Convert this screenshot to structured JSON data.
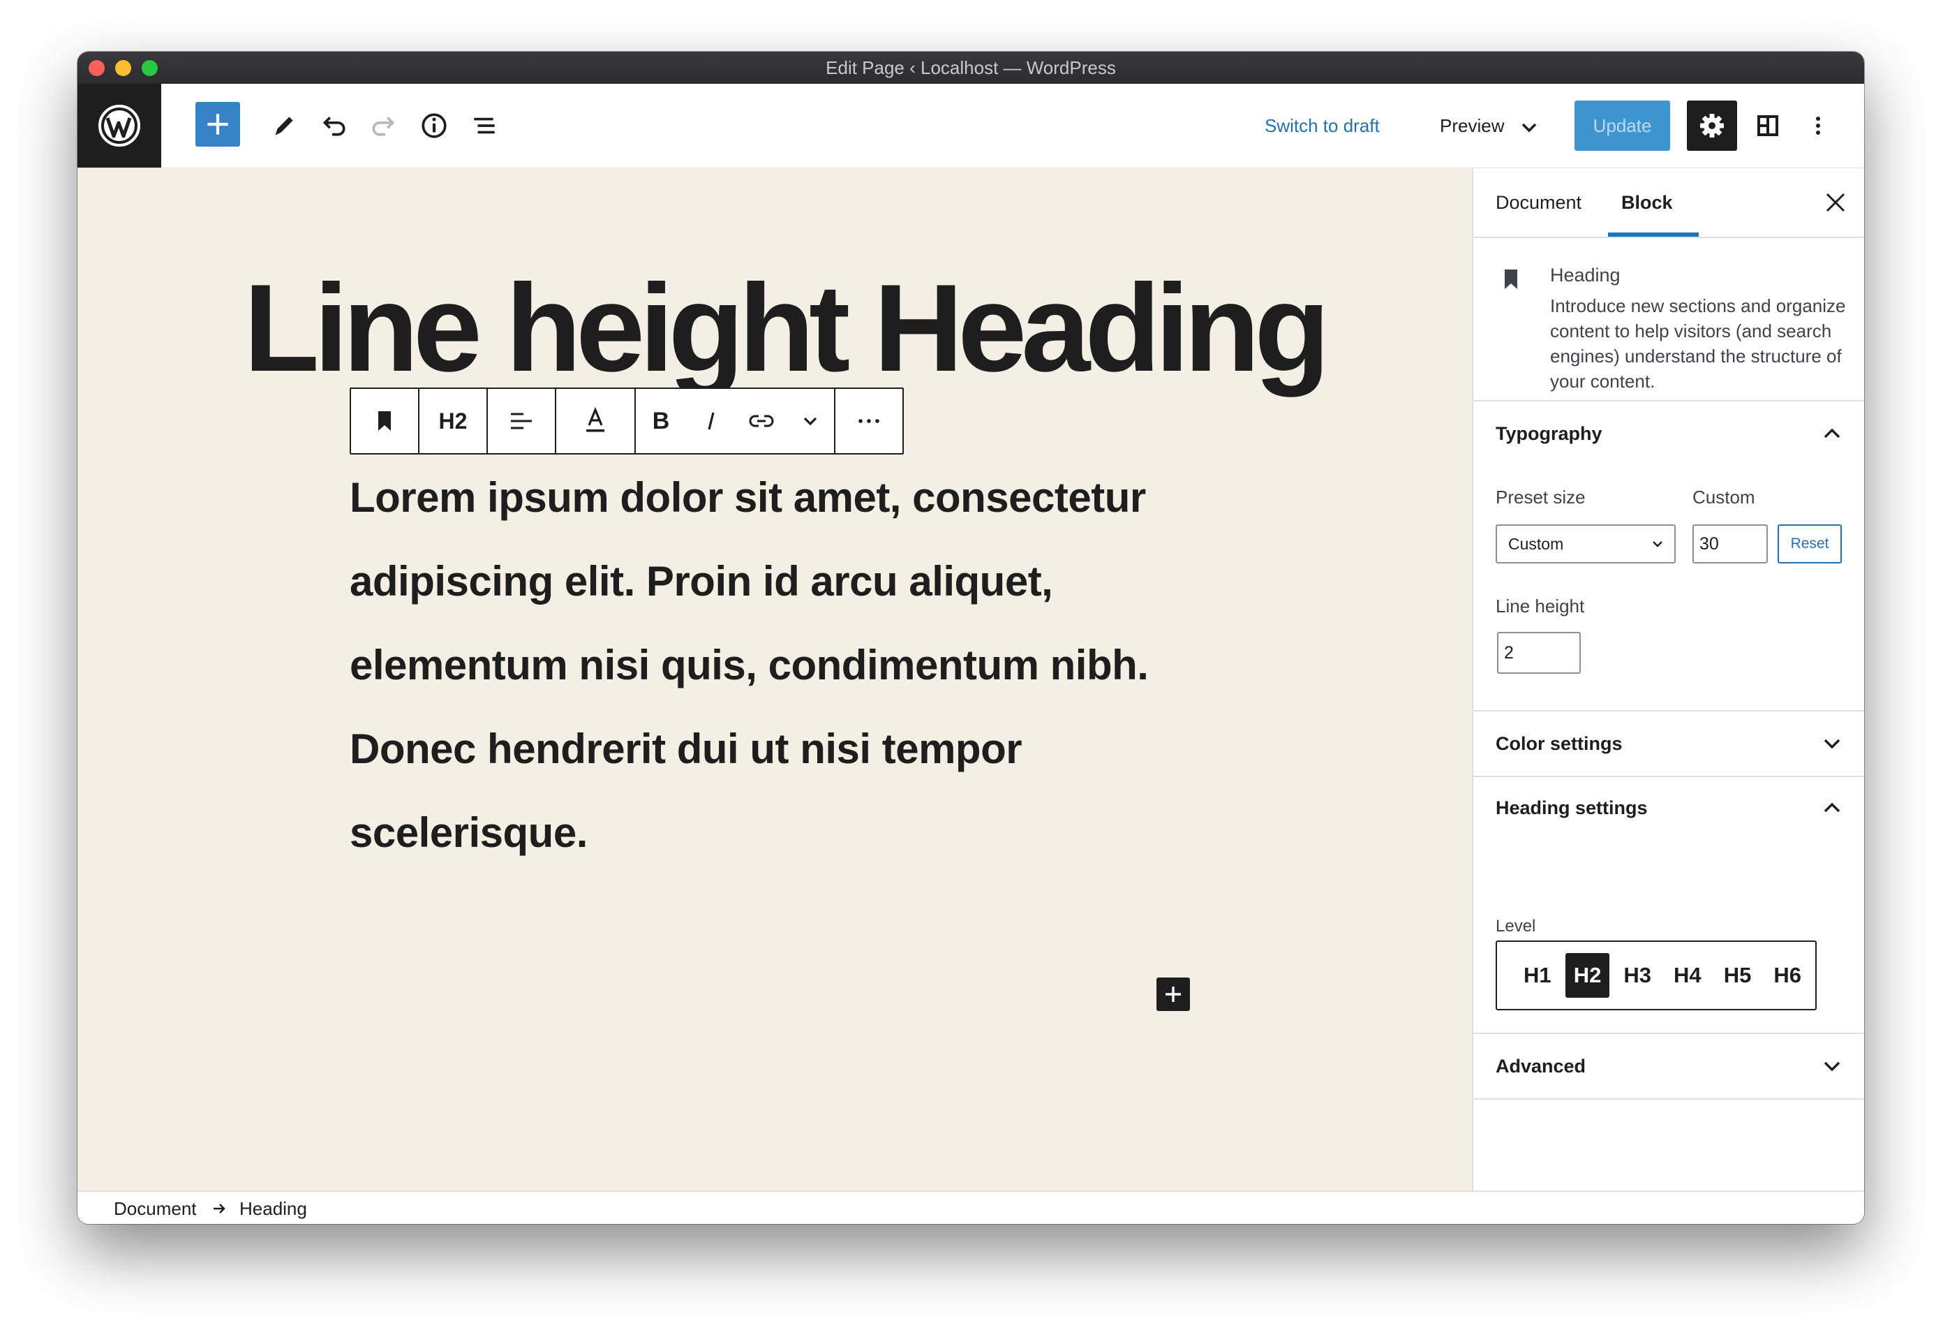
{
  "window": {
    "title": "Edit Page ‹ Localhost — WordPress"
  },
  "header": {
    "switch_to_draft": "Switch to draft",
    "preview": "Preview",
    "update": "Update"
  },
  "canvas": {
    "heading": "Line height Heading",
    "paragraph": "Lorem ipsum dolor sit amet, consectetur adipiscing elit. Proin id arcu aliquet, elementum nisi quis, condimentum nibh. Donec hendrerit dui ut nisi tempor scelerisque."
  },
  "block_toolbar": {
    "heading_level": "H2"
  },
  "sidebar": {
    "tabs": [
      {
        "label": "Document",
        "active": false
      },
      {
        "label": "Block",
        "active": true
      }
    ],
    "block_card": {
      "title": "Heading",
      "description": "Introduce new sections and organize content to help visitors (and search engines) understand the structure of your content."
    },
    "typography": {
      "title": "Typography",
      "expanded": true,
      "preset_size_label": "Preset size",
      "preset_size_value": "Custom",
      "custom_label": "Custom",
      "custom_value": "30",
      "reset_label": "Reset",
      "line_height_label": "Line height",
      "line_height_value": "2"
    },
    "color_settings": {
      "title": "Color settings",
      "expanded": false
    },
    "heading_settings": {
      "title": "Heading settings",
      "expanded": true,
      "level_label": "Level",
      "levels": [
        "H1",
        "H2",
        "H3",
        "H4",
        "H5",
        "H6"
      ],
      "selected_level": "H2"
    },
    "advanced": {
      "title": "Advanced",
      "expanded": false
    }
  },
  "footer": {
    "breadcrumb": [
      "Document",
      "Heading"
    ]
  },
  "colors": {
    "canvas_bg": "#f4efe4",
    "accent": "#2271b1",
    "add_button": "#3582c4",
    "update_button": "#3f95d0",
    "dark": "#1e1e1e"
  }
}
